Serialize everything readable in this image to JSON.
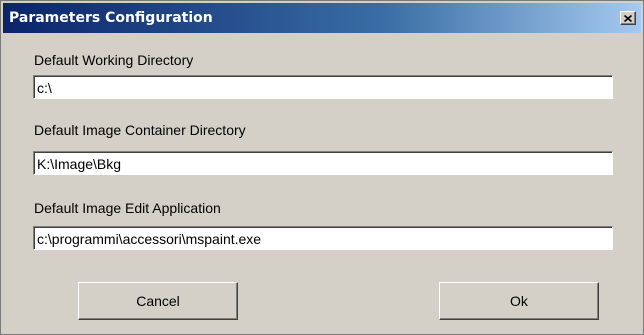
{
  "window": {
    "title": "Parameters Configuration",
    "close_icon": "close-icon"
  },
  "fields": {
    "working_dir": {
      "label": "Default Working Directory",
      "value": "c:\\"
    },
    "image_container_dir": {
      "label": "Default Image Container Directory",
      "value": "K:\\Image\\Bkg"
    },
    "image_edit_app": {
      "label": "Default Image Edit Application",
      "value": "c:\\programmi\\accessori\\mspaint.exe"
    }
  },
  "buttons": {
    "cancel_label": "Cancel",
    "ok_label": "Ok"
  },
  "colors": {
    "titlebar_start": "#0a246a",
    "titlebar_end": "#a6caf0",
    "face": "#d4d0c8"
  }
}
